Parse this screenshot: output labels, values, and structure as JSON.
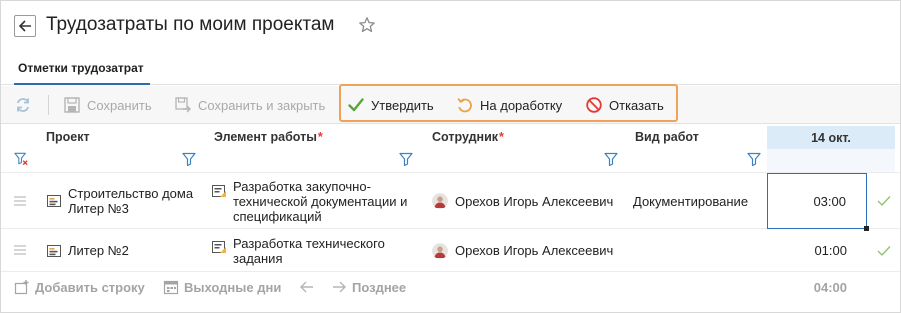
{
  "header": {
    "title": "Трудозатраты по моим проектам"
  },
  "tabs": [
    {
      "label": "Отметки трудозатрат",
      "active": true
    }
  ],
  "toolbar": {
    "refresh_icon": "refresh-icon",
    "save_label": "Сохранить",
    "save_close_label": "Сохранить и закрыть",
    "approve_label": "Утвердить",
    "rework_label": "На доработку",
    "reject_label": "Отказать"
  },
  "table": {
    "columns": {
      "project": "Проект",
      "work_item": "Элемент работы",
      "employee": "Сотрудник",
      "work_type": "Вид работ",
      "date": "14 окт."
    },
    "required_mark": "*",
    "rows": [
      {
        "project": "Строительство дома Литер №3",
        "work_item": "Разработка закупочно-технической документации и спецификаций",
        "employee": "Орехов Игорь Алексеевич",
        "work_type": "Документирование",
        "time": "03:00"
      },
      {
        "project": "Литер №2",
        "work_item": "Разработка технического задания",
        "employee": "Орехов Игорь Алексеевич",
        "work_type": "",
        "time": "01:00"
      }
    ]
  },
  "footer": {
    "add_row_label": "Добавить строку",
    "weekends_label": "Выходные дни",
    "later_label": "Позднее",
    "total": "04:00"
  },
  "colors": {
    "accent": "#2b6cb0",
    "approve": "#5aa63c",
    "rework": "#e8a34a",
    "reject": "#e53935",
    "highlight": "#f0a15a",
    "date_header_bg": "#dcebf8"
  }
}
